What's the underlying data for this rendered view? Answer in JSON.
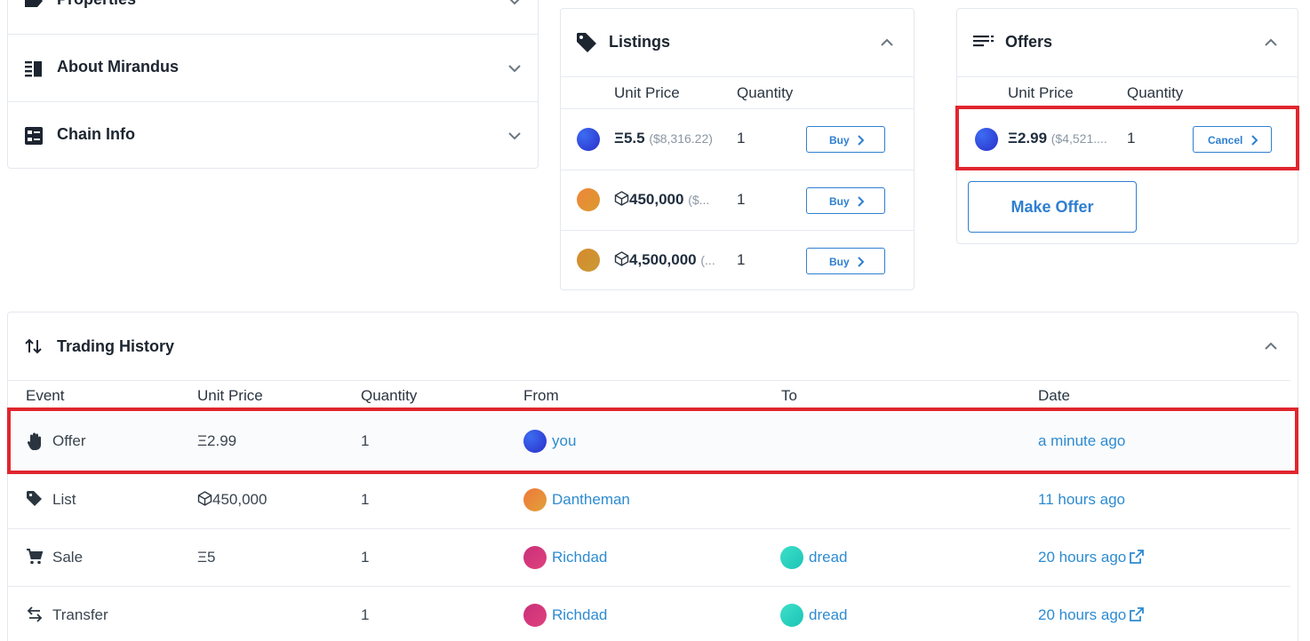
{
  "left_panel": {
    "sections": [
      {
        "label": "Properties",
        "icon": "label-icon"
      },
      {
        "label": "About Mirandus",
        "icon": "book-icon"
      },
      {
        "label": "Chain Info",
        "icon": "list-box-icon"
      }
    ]
  },
  "listings": {
    "title": "Listings",
    "headers": {
      "unit_price": "Unit Price",
      "quantity": "Quantity"
    },
    "rows": [
      {
        "price": "Ξ5.5",
        "usd": "($8,316.22)",
        "qty": "1",
        "button": "Buy"
      },
      {
        "price": "450,000",
        "usd": "($...",
        "qty": "1",
        "button": "Buy"
      },
      {
        "price": "4,500,000",
        "usd": "(...",
        "qty": "1",
        "button": "Buy"
      }
    ]
  },
  "offers": {
    "title": "Offers",
    "headers": {
      "unit_price": "Unit Price",
      "quantity": "Quantity"
    },
    "rows": [
      {
        "price": "Ξ2.99",
        "usd": "($4,521....",
        "qty": "1",
        "button": "Cancel"
      }
    ],
    "make_offer": "Make Offer"
  },
  "history": {
    "title": "Trading History",
    "headers": {
      "event": "Event",
      "unit_price": "Unit Price",
      "quantity": "Quantity",
      "from": "From",
      "to": "To",
      "date": "Date"
    },
    "rows": [
      {
        "event": "Offer",
        "price": "Ξ2.99",
        "qty": "1",
        "from": "you",
        "to": "",
        "date": "a minute ago"
      },
      {
        "event": "List",
        "price": "450,000",
        "qty": "1",
        "from": "Dantheman",
        "to": "",
        "date": "11 hours ago"
      },
      {
        "event": "Sale",
        "price": "Ξ5",
        "qty": "1",
        "from": "Richdad",
        "to": "dread",
        "date": "20 hours ago"
      },
      {
        "event": "Transfer",
        "price": "",
        "qty": "1",
        "from": "Richdad",
        "to": "dread",
        "date": "20 hours ago"
      }
    ]
  },
  "colors": {
    "accent": "#2f7fd0",
    "link": "#2d8bd1",
    "highlight": "#e0262e"
  }
}
